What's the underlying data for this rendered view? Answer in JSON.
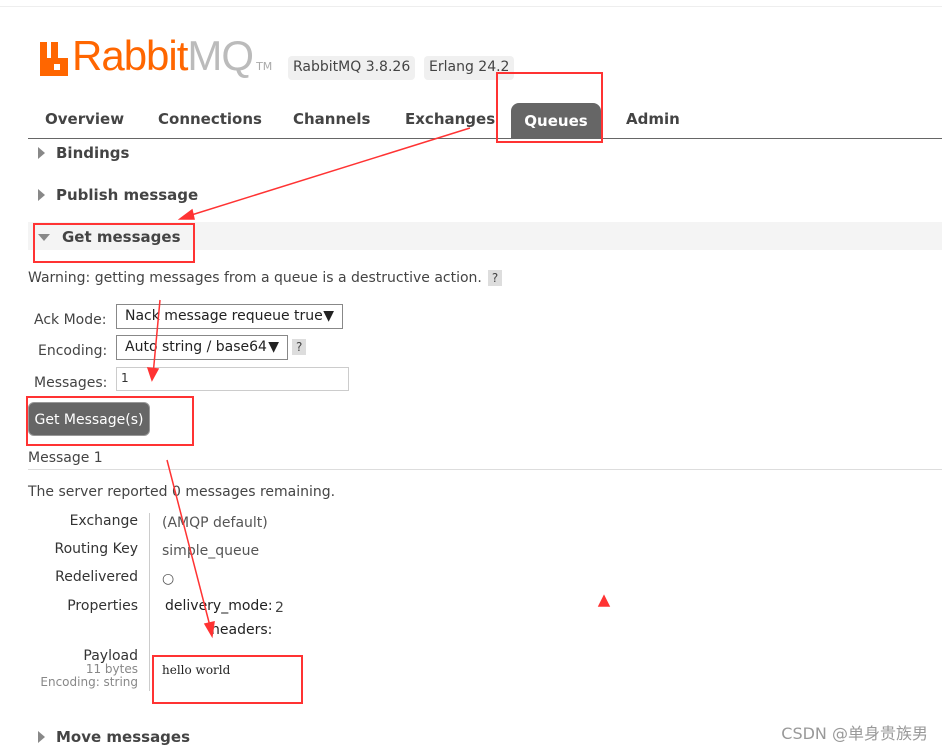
{
  "header": {
    "logo_text_rabbit": "Rabbit",
    "logo_text_mq": "MQ",
    "logo_tm": "TM",
    "version_badge": "RabbitMQ 3.8.26",
    "erlang_badge": "Erlang 24.2"
  },
  "nav": {
    "tabs": [
      {
        "label": "Overview"
      },
      {
        "label": "Connections"
      },
      {
        "label": "Channels"
      },
      {
        "label": "Exchanges"
      },
      {
        "label": "Queues",
        "active": true
      },
      {
        "label": "Admin"
      }
    ]
  },
  "sections": {
    "bindings": "Bindings",
    "publish": "Publish message",
    "get": "Get messages",
    "move": "Move messages"
  },
  "get_messages": {
    "warning": "Warning: getting messages from a queue is a destructive action.",
    "help": "?",
    "ack_mode_label": "Ack Mode:",
    "ack_mode_value": "Nack message requeue true",
    "encoding_label": "Encoding:",
    "encoding_value": "Auto string / base64",
    "messages_label": "Messages:",
    "messages_value": "1",
    "button": "Get Message(s)"
  },
  "result": {
    "title": "Message 1",
    "remaining": "The server reported 0 messages remaining.",
    "exchange_label": "Exchange",
    "exchange": "(AMQP default)",
    "routing_key_label": "Routing Key",
    "routing_key": "simple_queue",
    "redelivered_label": "Redelivered",
    "redelivered": "○",
    "properties_label": "Properties",
    "delivery_mode_key": "delivery_mode:",
    "delivery_mode": "2",
    "headers_key": "headers:",
    "payload_label": "Payload",
    "payload_size": "11 bytes",
    "payload_encoding": "Encoding: string",
    "payload": "hello world"
  },
  "watermark": "CSDN @单身贵族男",
  "colors": {
    "accent": "#ff6600",
    "annotation": "#ff3333",
    "tab_active": "#666666"
  }
}
